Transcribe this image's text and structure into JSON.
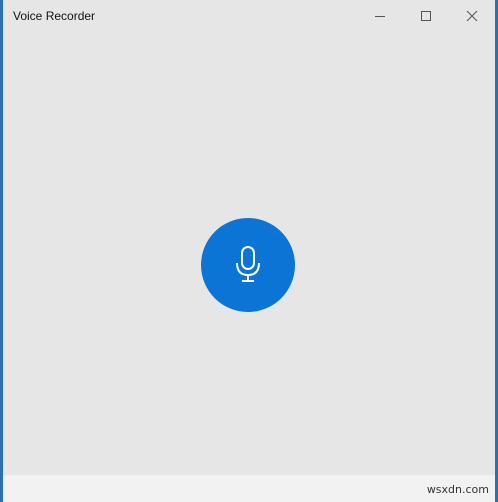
{
  "window": {
    "title": "Voice Recorder"
  },
  "caption_buttons": [
    {
      "name": "minimize",
      "icon": "minimize-icon"
    },
    {
      "name": "maximize",
      "icon": "maximize-icon"
    },
    {
      "name": "close",
      "icon": "close-icon"
    }
  ],
  "main": {
    "record_button_icon": "microphone-icon"
  },
  "footer": {
    "watermark": "wsxdn.com"
  },
  "colors": {
    "window_bg": "#e6e6e6",
    "accent": "#0b74d4",
    "desktop_edge": "#2f6fb0"
  }
}
